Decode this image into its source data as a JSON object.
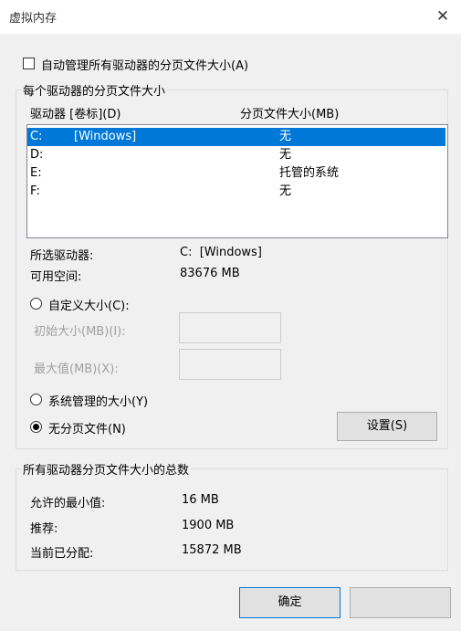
{
  "window": {
    "title": "虚拟内存",
    "close_glyph": "✕"
  },
  "auto_manage": {
    "label": "自动管理所有驱动器的分页文件大小(A)",
    "checked": false
  },
  "per_drive": {
    "group_label": "每个驱动器的分页文件大小",
    "columns": [
      "驱动器 [卷标](D)",
      "分页文件大小(MB)"
    ],
    "rows": [
      {
        "drive": "C:",
        "label": "[Windows]",
        "size": "无",
        "selected": true
      },
      {
        "drive": "D:",
        "label": "",
        "size": "无",
        "selected": false
      },
      {
        "drive": "E:",
        "label": "",
        "size": "托管的系统",
        "selected": false
      },
      {
        "drive": "F:",
        "label": "",
        "size": "无",
        "selected": false
      }
    ],
    "selected_drive_label": "所选驱动器:",
    "selected_drive_value": "C:  [Windows]",
    "free_space_label": "可用空间:",
    "free_space_value": "83676 MB",
    "custom_size_label": "自定义大小(C):",
    "initial_size_label": "初始大小(MB)(I):",
    "max_size_label": "最大值(MB)(X):",
    "system_managed_label": "系统管理的大小(Y)",
    "no_paging_label": "无分页文件(N)",
    "set_button": "设置(S)"
  },
  "totals": {
    "group_label": "所有驱动器分页文件大小的总数",
    "min_allowed_label": "允许的最小值:",
    "min_allowed_value": "16 MB",
    "recommended_label": "推荐:",
    "recommended_value": "1900 MB",
    "current_label": "当前已分配:",
    "current_value": "15872 MB"
  },
  "buttons": {
    "ok": "确定"
  }
}
